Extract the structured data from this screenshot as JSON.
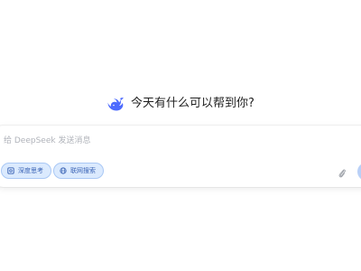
{
  "greeting": {
    "text": "今天有什么可以帮到你?"
  },
  "composer": {
    "placeholder": "给 DeepSeek 发送消息",
    "value": ""
  },
  "toggles": {
    "deep_think_label": "深度思考",
    "web_search_label": "联网搜索"
  },
  "icons": {
    "logo": "deepseek-whale-logo",
    "deep_think": "atom-icon",
    "web_search": "globe-icon",
    "attach": "paperclip-icon",
    "send": "send-arrow-icon"
  },
  "colors": {
    "brand": "#4d6bfe",
    "chip_bg": "#dbeafe",
    "chip_border": "#a9c8f5",
    "chip_text": "#3b64b5",
    "send_bg": "#b9d0f7"
  }
}
